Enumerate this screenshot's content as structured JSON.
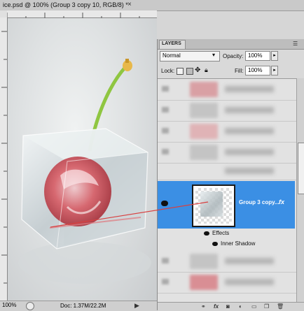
{
  "document": {
    "tab_title": "ice.psd @ 100% (Group 3 copy 10, RGB/8) *",
    "close_glyph": "×"
  },
  "status_bar": {
    "zoom": "100%",
    "doc_info": "Doc: 1.37M/22.2M"
  },
  "layers_panel": {
    "tab_label": "LAYERS",
    "blend_mode": "Normal",
    "opacity_label": "Opacity:",
    "opacity_value": "100%",
    "lock_label": "Lock:",
    "fill_label": "Fill:",
    "fill_value": "100%",
    "selected_layer": {
      "name": "Group 3 copy...",
      "fx_badge": "fx"
    },
    "effects_label": "Effects",
    "inner_shadow_label": "Inner Shadow"
  },
  "colors": {
    "selection": "#3b8fe4",
    "callout_line": "#d84040",
    "panel_bg": "#d9d9d9"
  },
  "icons": [
    "eye-icon",
    "lock-transparent-icon",
    "lock-image-icon",
    "lock-position-icon",
    "lock-all-icon",
    "link-icon",
    "fx-icon",
    "mask-icon",
    "adjustment-icon",
    "folder-icon",
    "new-layer-icon",
    "trash-icon"
  ]
}
